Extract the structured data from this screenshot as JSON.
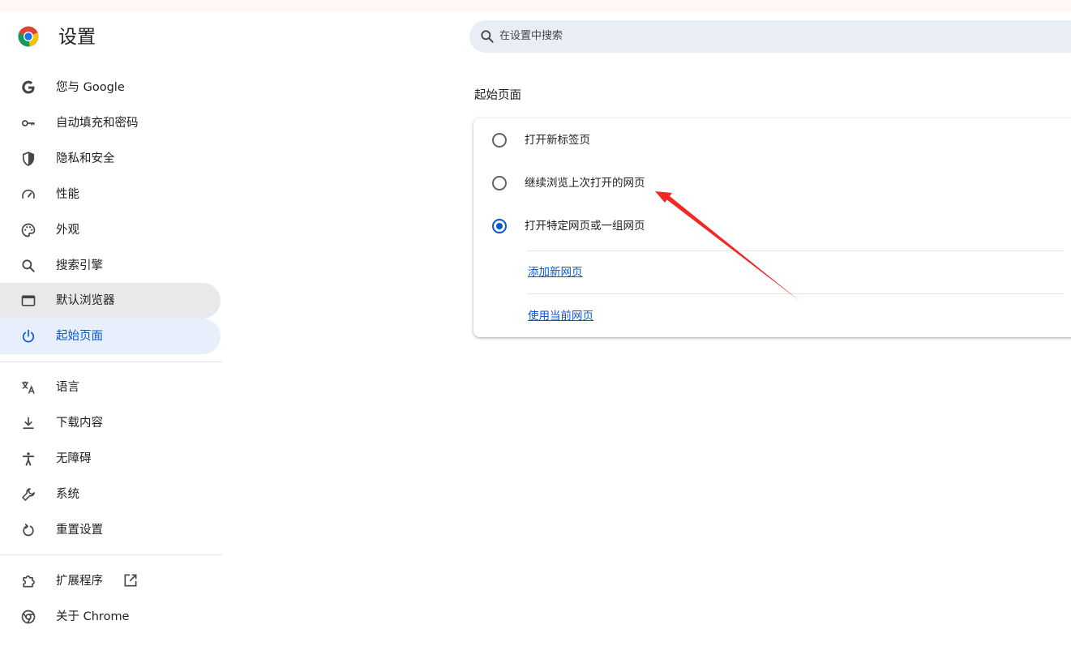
{
  "header": {
    "title": "设置",
    "logo_icon": "chrome-logo-icon",
    "search": {
      "placeholder": "在设置中搜索",
      "icon": "search-icon"
    }
  },
  "sidebar": {
    "items": [
      {
        "label": "您与 Google",
        "icon": "google-g-icon",
        "state": "normal"
      },
      {
        "label": "自动填充和密码",
        "icon": "key-icon",
        "state": "normal"
      },
      {
        "label": "隐私和安全",
        "icon": "shield-icon",
        "state": "normal"
      },
      {
        "label": "性能",
        "icon": "speedometer-icon",
        "state": "normal"
      },
      {
        "label": "外观",
        "icon": "palette-icon",
        "state": "normal"
      },
      {
        "label": "搜索引擎",
        "icon": "search-icon",
        "state": "normal"
      },
      {
        "label": "默认浏览器",
        "icon": "browser-window-icon",
        "state": "hover"
      },
      {
        "label": "起始页面",
        "icon": "power-icon",
        "state": "selected"
      }
    ],
    "items_advanced": [
      {
        "label": "语言",
        "icon": "translate-icon"
      },
      {
        "label": "下载内容",
        "icon": "download-icon"
      },
      {
        "label": "无障碍",
        "icon": "accessibility-icon"
      },
      {
        "label": "系统",
        "icon": "wrench-icon"
      },
      {
        "label": "重置设置",
        "icon": "reset-icon"
      }
    ],
    "footer": [
      {
        "label": "扩展程序",
        "icon": "puzzle-icon",
        "trailing_icon": "open-in-new-icon"
      },
      {
        "label": "关于 Chrome",
        "icon": "chrome-outline-icon"
      }
    ]
  },
  "main": {
    "section_title": "起始页面",
    "options": [
      {
        "label": "打开新标签页",
        "checked": false
      },
      {
        "label": "继续浏览上次打开的网页",
        "checked": false
      },
      {
        "label": "打开特定网页或一组网页",
        "checked": true
      }
    ],
    "links": [
      {
        "label": "添加新网页"
      },
      {
        "label": "使用当前网页"
      }
    ]
  },
  "colors": {
    "accent": "#0b57d0",
    "selected_bg": "#e8effc",
    "hover_bg": "#e8e9eb",
    "search_bg": "#e9eef6",
    "annotation_arrow": "#f02a23"
  }
}
